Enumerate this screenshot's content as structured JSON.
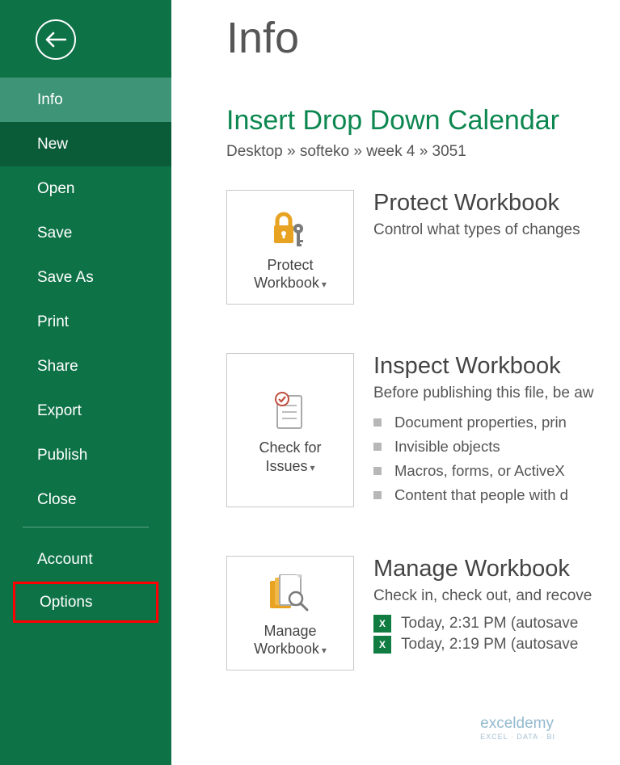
{
  "sidebar": {
    "items": [
      {
        "label": "Info"
      },
      {
        "label": "New"
      },
      {
        "label": "Open"
      },
      {
        "label": "Save"
      },
      {
        "label": "Save As"
      },
      {
        "label": "Print"
      },
      {
        "label": "Share"
      },
      {
        "label": "Export"
      },
      {
        "label": "Publish"
      },
      {
        "label": "Close"
      }
    ],
    "footer_items": [
      {
        "label": "Account"
      },
      {
        "label": "Options"
      }
    ]
  },
  "page": {
    "title": "Info",
    "doc_title": "Insert Drop Down Calendar",
    "breadcrumb": "Desktop » softeko » week 4 » 3051"
  },
  "sections": {
    "protect": {
      "button_label": "Protect Workbook",
      "heading": "Protect Workbook",
      "desc": "Control what types of changes "
    },
    "inspect": {
      "button_label": "Check for Issues",
      "heading": "Inspect Workbook",
      "desc": "Before publishing this file, be aw",
      "bullets": [
        "Document properties, prin",
        "Invisible objects",
        "Macros, forms, or ActiveX ",
        "Content that people with d"
      ]
    },
    "manage": {
      "button_label": "Manage Workbook",
      "heading": "Manage Workbook",
      "desc": "Check in, check out, and recove",
      "versions": [
        "Today, 2:31 PM (autosave",
        "Today, 2:19 PM (autosave"
      ]
    }
  },
  "watermark": {
    "brand": "exceldemy",
    "sub": "EXCEL · DATA · BI"
  }
}
